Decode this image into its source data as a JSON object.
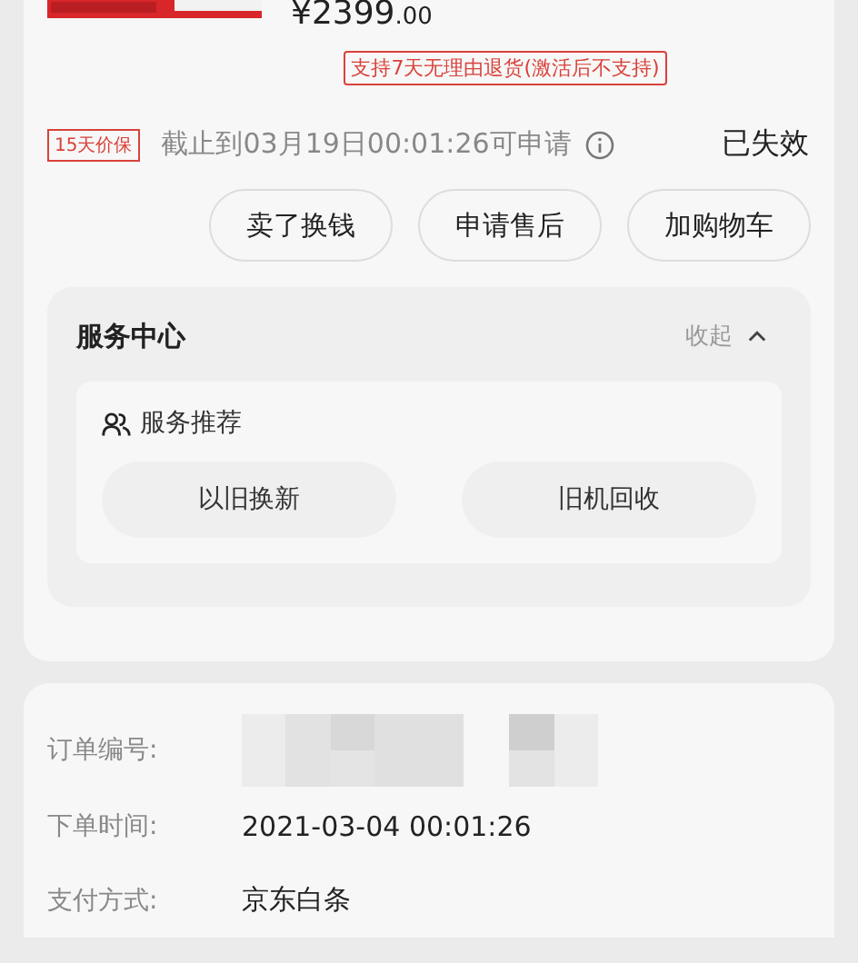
{
  "product": {
    "price_main": "¥2399",
    "price_cents": ".00",
    "return_policy": "支持7天无理由退货(激活后不支持)"
  },
  "price_protection": {
    "tag": "15天价保",
    "deadline": "截止到03月19日00:01:26可申请",
    "status": "已失效"
  },
  "actions": [
    "卖了换钱",
    "申请售后",
    "加购物车"
  ],
  "service_center": {
    "title": "服务中心",
    "toggle": "收起",
    "expanded": true,
    "section_title": "服务推荐",
    "services": [
      "以旧换新",
      "旧机回收"
    ]
  },
  "order_info": [
    {
      "label": "订单编号:",
      "kind": "redacted"
    },
    {
      "label": "下单时间:",
      "kind": "text",
      "value": "2021-03-04 00:01:26"
    },
    {
      "label": "支付方式:",
      "kind": "text",
      "value": "京东白条"
    }
  ]
}
